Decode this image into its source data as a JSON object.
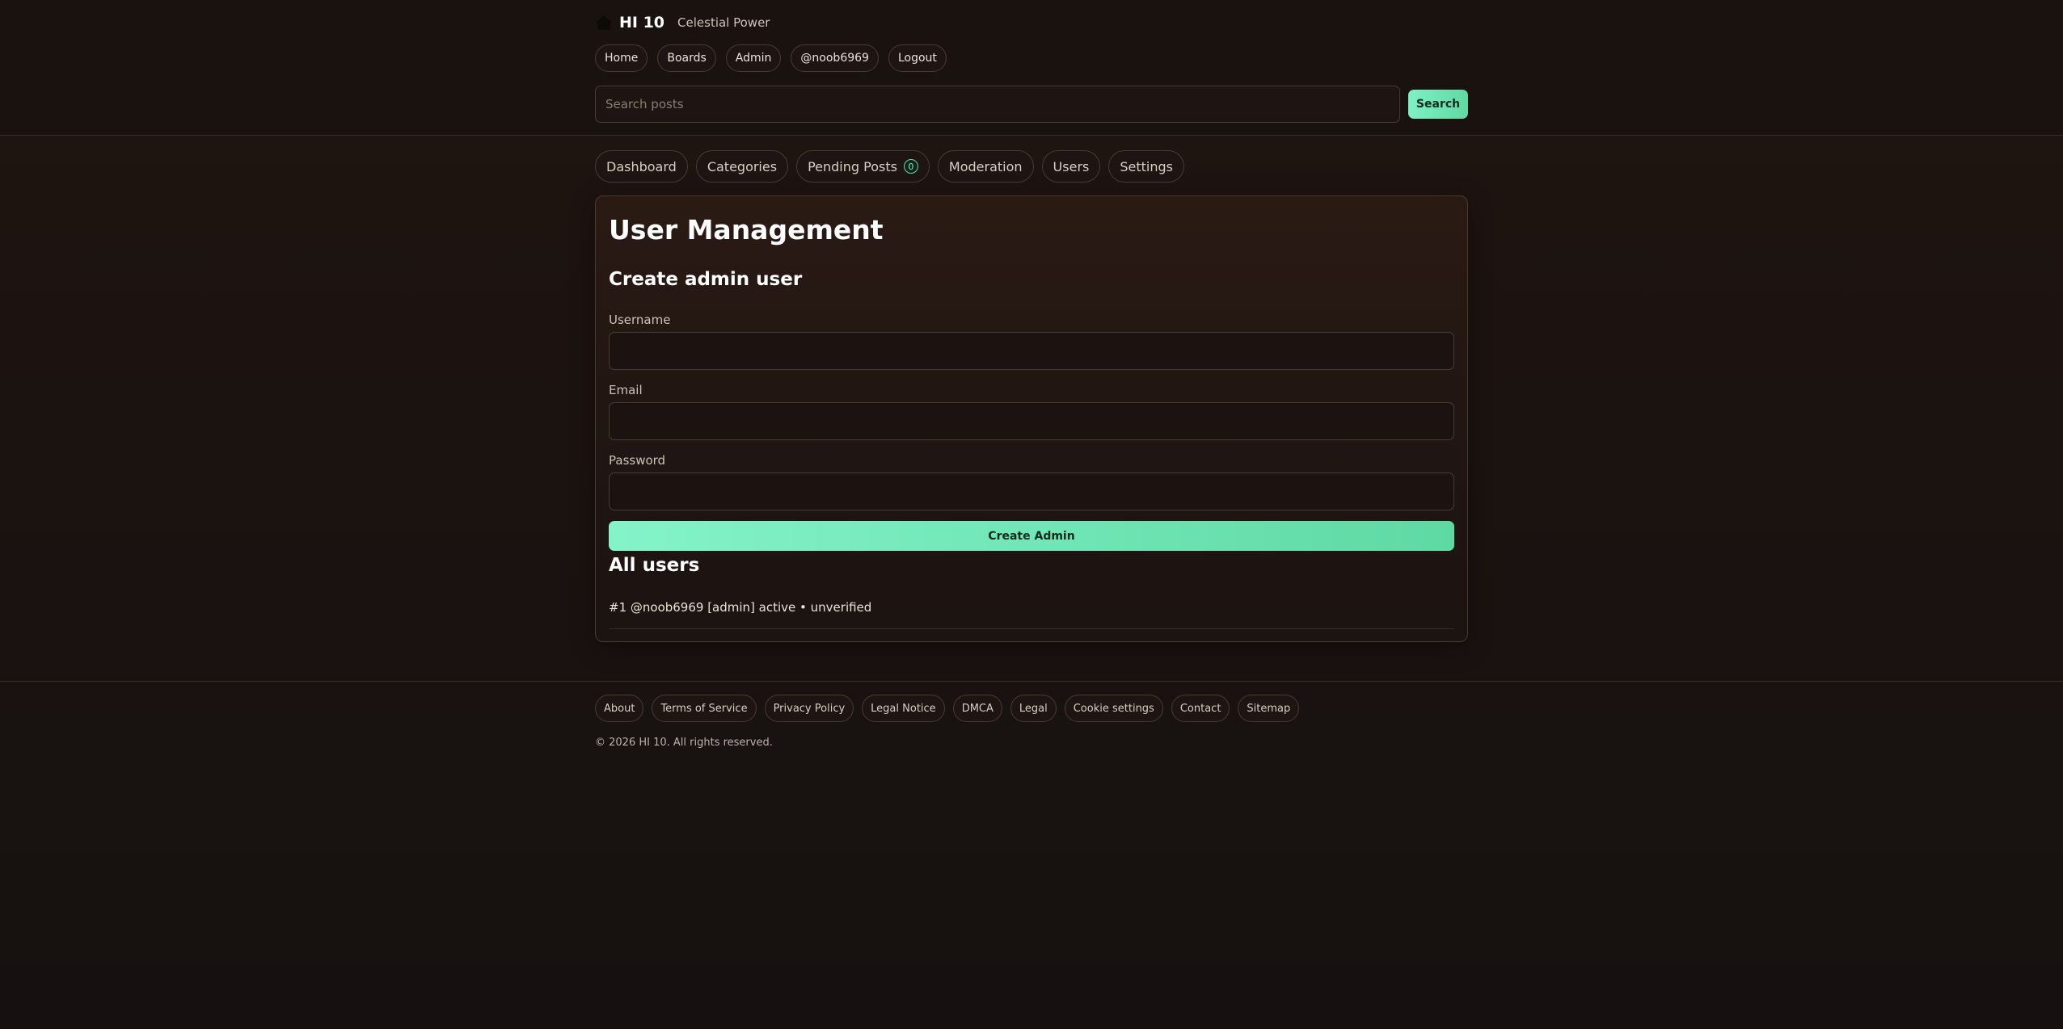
{
  "header": {
    "site_name": "HI 10",
    "tagline": "Celestial Power",
    "home_icon": "home-icon",
    "nav": [
      "Home",
      "Boards",
      "Admin",
      "@noob6969",
      "Logout"
    ],
    "search_placeholder": "Search posts",
    "search_value": "",
    "search_button": "Search"
  },
  "admin_tabs": {
    "dashboard": "Dashboard",
    "categories": "Categories",
    "pending_posts": "Pending Posts",
    "pending_count": "0",
    "moderation": "Moderation",
    "users": "Users",
    "settings": "Settings"
  },
  "panel": {
    "title": "User Management",
    "create_section": "Create admin user",
    "username_label": "Username",
    "username_value": "",
    "email_label": "Email",
    "email_value": "",
    "password_label": "Password",
    "password_value": "",
    "create_button": "Create Admin",
    "all_users_title": "All users",
    "users": [
      "#1 @noob6969 [admin] active • unverified"
    ]
  },
  "footer": {
    "links": [
      "About",
      "Terms of Service",
      "Privacy Policy",
      "Legal Notice",
      "DMCA",
      "Legal",
      "Cookie settings",
      "Contact",
      "Sitemap"
    ],
    "copyright": "© 2026 HI 10. All rights reserved."
  },
  "colors": {
    "accent": "#6ee6b4",
    "background": "#1b1310",
    "border": "#4a3a31"
  }
}
